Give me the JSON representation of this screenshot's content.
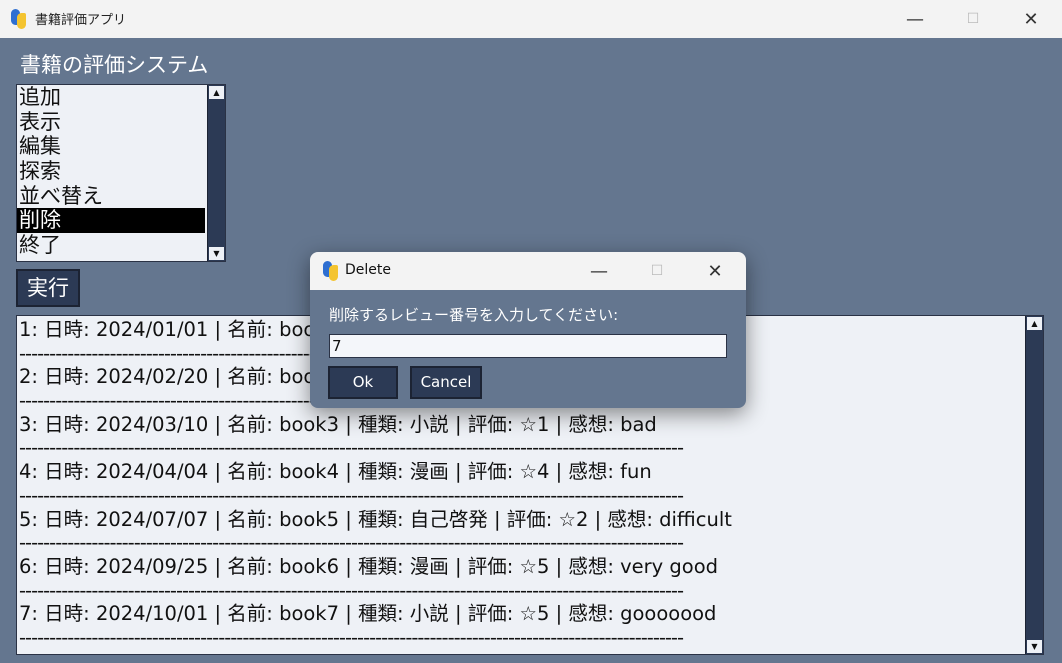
{
  "window": {
    "title": "書籍評価アプリ",
    "controls": {
      "minimize": "—",
      "maximize": "☐",
      "close": "✕"
    }
  },
  "heading": "書籍の評価システム",
  "menu": {
    "items": [
      "追加",
      "表示",
      "編集",
      "探索",
      "並べ替え",
      "削除",
      "終了"
    ],
    "selected": "削除"
  },
  "execute_label": "実行",
  "reviews": [
    "1: 日時: 2024/01/01 | 名前: book1 | 種類: 小説 | 評価: ☆5 | 感想: good",
    "2: 日時: 2024/02/20 | 名前: book2 | 種類: 漫画 | 評価: ☆3 | 感想: normal",
    "3: 日時: 2024/03/10 | 名前: book3 | 種類: 小説 | 評価: ☆1 | 感想: bad",
    "4: 日時: 2024/04/04 | 名前: book4 | 種類: 漫画 | 評価: ☆4 | 感想: fun",
    "5: 日時: 2024/07/07 | 名前: book5 | 種類: 自己啓発 | 評価: ☆2 | 感想: difficult",
    "6: 日時: 2024/09/25 | 名前: book6 | 種類: 漫画 | 評価: ☆5 | 感想: very good",
    "7: 日時: 2024/10/01 | 名前: book7 | 種類: 小説 | 評価: ☆5 | 感想: gooooood"
  ],
  "separator": "--------------------------------------------------------------------------------------------------------------",
  "dialog": {
    "title": "Delete",
    "prompt": "削除するレビュー番号を入力してください:",
    "input_value": "7",
    "ok_label": "Ok",
    "cancel_label": "Cancel",
    "controls": {
      "minimize": "—",
      "maximize": "☐",
      "close": "✕"
    }
  },
  "scroll_arrows": {
    "up": "▲",
    "down": "▼"
  },
  "colors": {
    "background": "#64768f",
    "button": "#2c3a55",
    "list_bg": "#eef1f6",
    "selection": "#000000",
    "icon_blue": "#2f6fd1",
    "icon_yellow": "#f4c430"
  }
}
